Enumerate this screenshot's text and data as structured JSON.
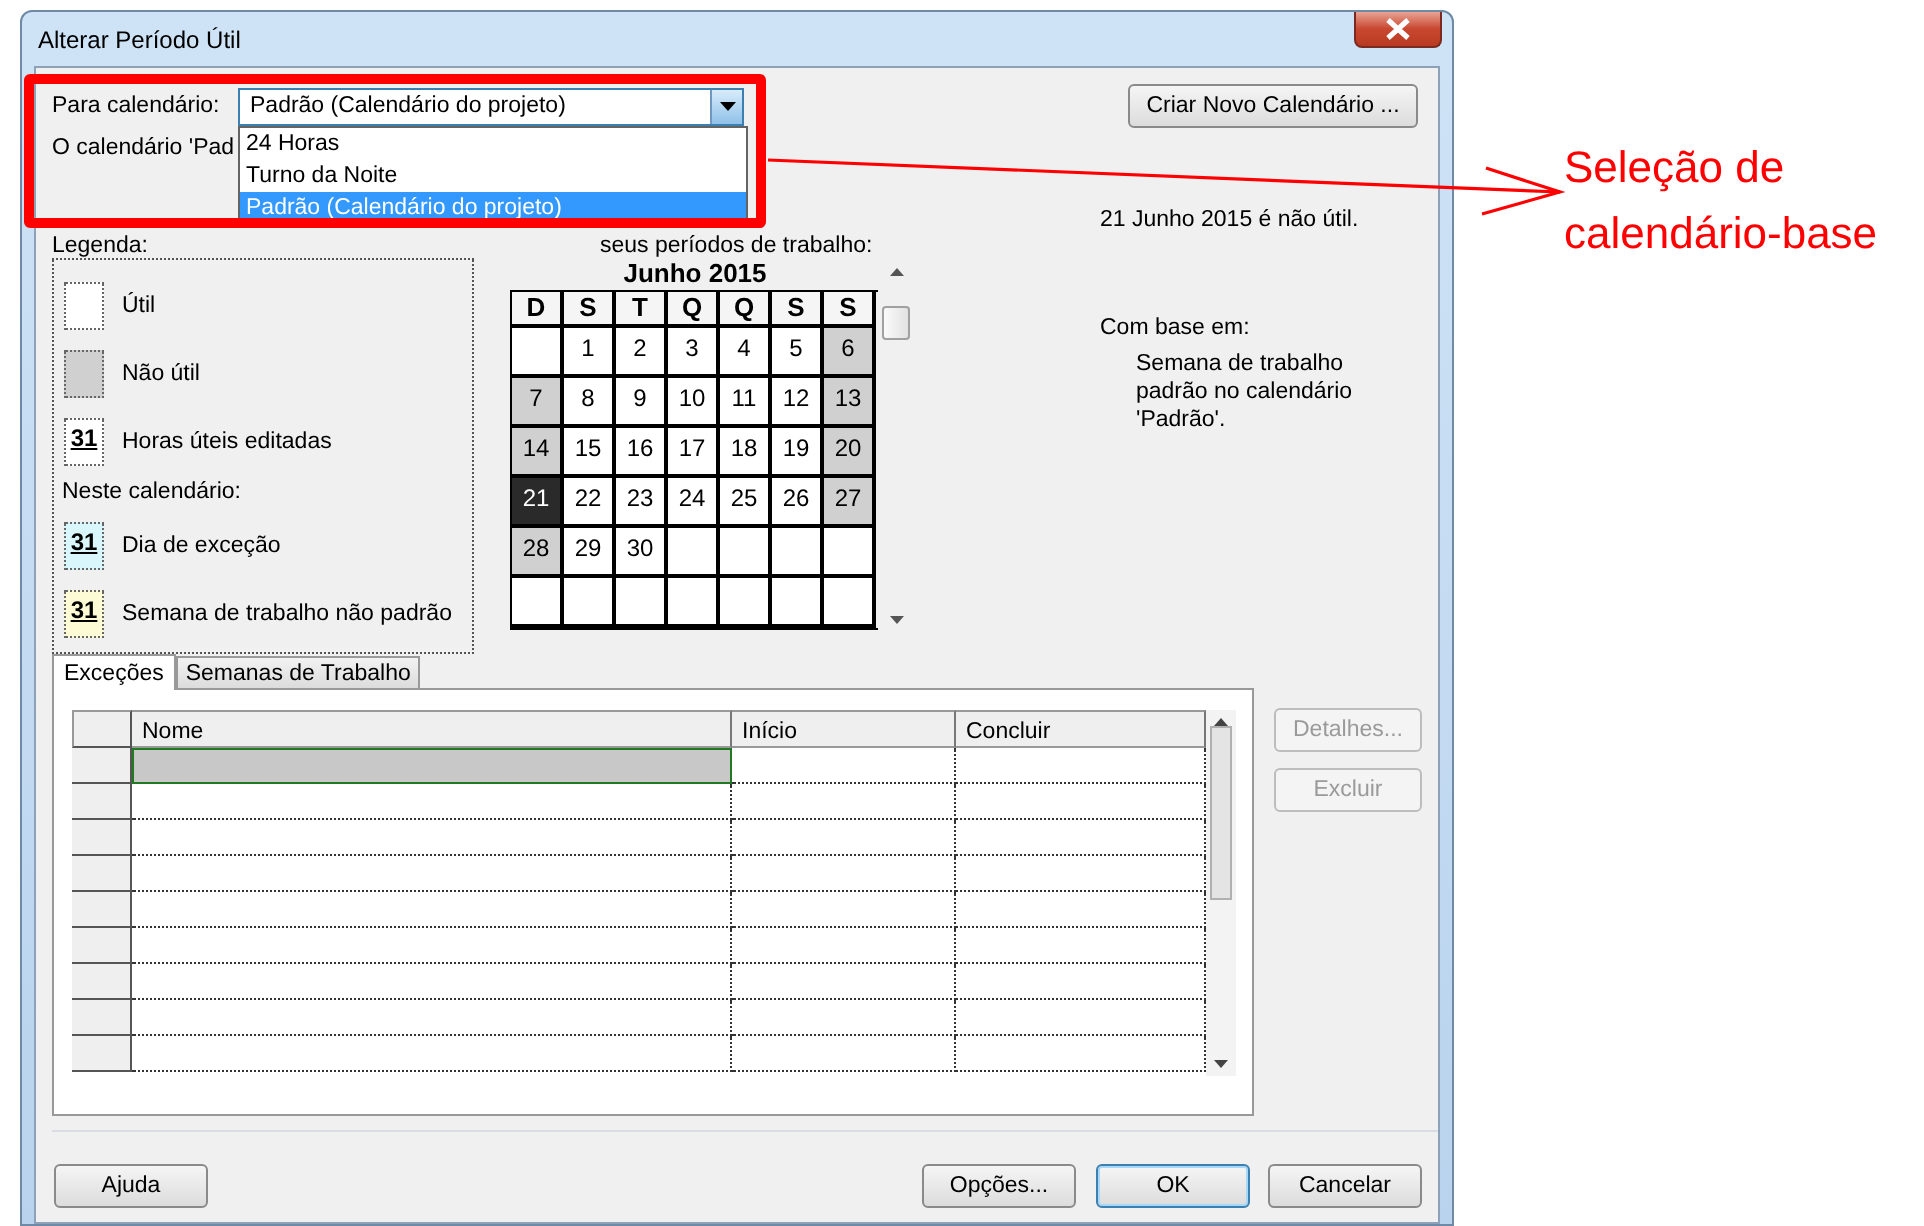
{
  "window": {
    "title": "Alterar Período Útil"
  },
  "calendar_picker": {
    "label": "Para calendário:",
    "value": "Padrão (Calendário do projeto)",
    "expanded": true,
    "options": [
      {
        "label": "24 Horas",
        "selected": false
      },
      {
        "label": "Turno da Noite",
        "selected": false
      },
      {
        "label": "Padrão (Calendário do projeto)",
        "selected": true
      }
    ]
  },
  "new_calendar_button": "Criar Novo Calendário ...",
  "calendar_note": "O calendário 'Pad",
  "legend": {
    "title": "Legenda:",
    "items": [
      {
        "kind": "working",
        "label": "Útil"
      },
      {
        "kind": "nonworking",
        "label": "Não útil"
      },
      {
        "kind": "edited",
        "mark": "31",
        "label": "Horas úteis editadas"
      }
    ],
    "subheading": "Neste calendário:",
    "sub_items": [
      {
        "kind": "exception",
        "mark": "31",
        "label": "Dia de exceção"
      },
      {
        "kind": "nondefault",
        "mark": "31",
        "label": "Semana de trabalho não padrão"
      }
    ]
  },
  "instruction": "seus períodos de trabalho:",
  "month": {
    "title": "Junho 2015",
    "weekdays": [
      "D",
      "S",
      "T",
      "Q",
      "Q",
      "S",
      "S"
    ],
    "weeks": [
      [
        {
          "kind": "blank"
        },
        {
          "day": "1",
          "nonworking": false,
          "selected": false
        },
        {
          "day": "2",
          "nonworking": false,
          "selected": false
        },
        {
          "day": "3",
          "nonworking": false,
          "selected": false
        },
        {
          "day": "4",
          "nonworking": false,
          "selected": false
        },
        {
          "day": "5",
          "nonworking": false,
          "selected": false
        },
        {
          "day": "6",
          "nonworking": true,
          "selected": false
        }
      ],
      [
        {
          "day": "7",
          "nonworking": true,
          "selected": false
        },
        {
          "day": "8",
          "nonworking": false,
          "selected": false
        },
        {
          "day": "9",
          "nonworking": false,
          "selected": false
        },
        {
          "day": "10",
          "nonworking": false,
          "selected": false
        },
        {
          "day": "11",
          "nonworking": false,
          "selected": false
        },
        {
          "day": "12",
          "nonworking": false,
          "selected": false
        },
        {
          "day": "13",
          "nonworking": true,
          "selected": false
        }
      ],
      [
        {
          "day": "14",
          "nonworking": true,
          "selected": false
        },
        {
          "day": "15",
          "nonworking": false,
          "selected": false
        },
        {
          "day": "16",
          "nonworking": false,
          "selected": false
        },
        {
          "day": "17",
          "nonworking": false,
          "selected": false
        },
        {
          "day": "18",
          "nonworking": false,
          "selected": false
        },
        {
          "day": "19",
          "nonworking": false,
          "selected": false
        },
        {
          "day": "20",
          "nonworking": true,
          "selected": false
        }
      ],
      [
        {
          "day": "21",
          "nonworking": true,
          "selected": true
        },
        {
          "day": "22",
          "nonworking": false,
          "selected": false
        },
        {
          "day": "23",
          "nonworking": false,
          "selected": false
        },
        {
          "day": "24",
          "nonworking": false,
          "selected": false
        },
        {
          "day": "25",
          "nonworking": false,
          "selected": false
        },
        {
          "day": "26",
          "nonworking": false,
          "selected": false
        },
        {
          "day": "27",
          "nonworking": true,
          "selected": false
        }
      ],
      [
        {
          "day": "28",
          "nonworking": true,
          "selected": false
        },
        {
          "day": "29",
          "nonworking": false,
          "selected": false
        },
        {
          "day": "30",
          "nonworking": false,
          "selected": false
        },
        {
          "kind": "blank"
        },
        {
          "kind": "blank"
        },
        {
          "kind": "blank"
        },
        {
          "kind": "blank"
        }
      ],
      [
        {
          "kind": "blank"
        },
        {
          "kind": "blank"
        },
        {
          "kind": "blank"
        },
        {
          "kind": "blank"
        },
        {
          "kind": "blank"
        },
        {
          "kind": "blank"
        },
        {
          "kind": "blank"
        }
      ]
    ]
  },
  "day_status": "21 Junho 2015 é não útil.",
  "based_on": {
    "label": "Com base em:",
    "text": "Semana de trabalho padrão no calendário 'Padrão'."
  },
  "tabs": [
    {
      "label": "Exceções",
      "selected": true
    },
    {
      "label": "Semanas de Trabalho",
      "selected": false
    }
  ],
  "table": {
    "columns": [
      "Nome",
      "Início",
      "Concluir"
    ],
    "rows": [
      {
        "selected": true
      },
      {
        "selected": false
      },
      {
        "selected": false
      },
      {
        "selected": false
      },
      {
        "selected": false
      },
      {
        "selected": false
      },
      {
        "selected": false
      },
      {
        "selected": false
      },
      {
        "selected": false
      }
    ]
  },
  "side_buttons": [
    {
      "label": "Detalhes...",
      "disabled": true
    },
    {
      "label": "Excluir",
      "disabled": true
    }
  ],
  "footer_buttons": [
    {
      "label": "Ajuda",
      "default": false
    },
    {
      "label": "Opções...",
      "default": false
    },
    {
      "label": "OK",
      "default": true
    },
    {
      "label": "Cancelar",
      "default": false
    }
  ],
  "annotation": {
    "text": "Seleção de calendário-base"
  }
}
